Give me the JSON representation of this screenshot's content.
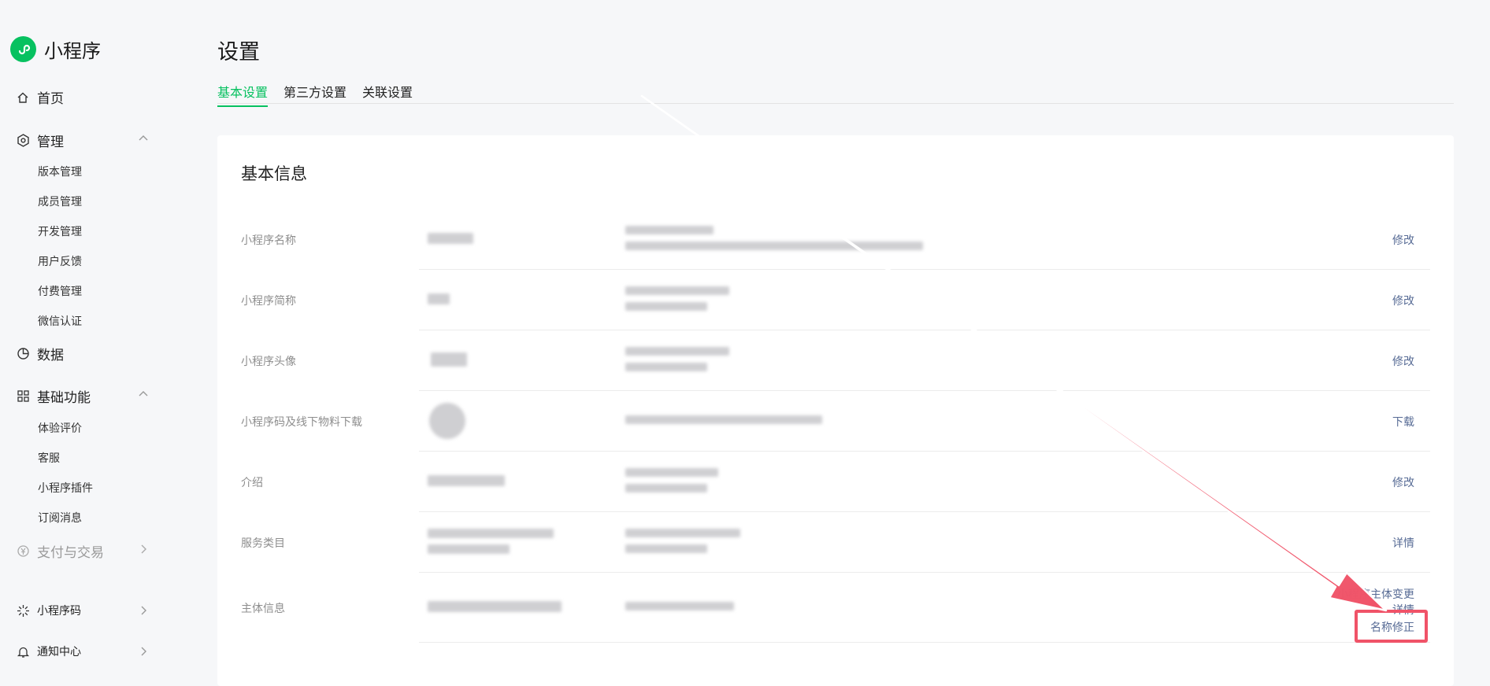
{
  "app": {
    "title": "小程序",
    "logo_icon": "mini-program-logo-icon",
    "brand_color": "#07c160"
  },
  "sidebar": {
    "home": {
      "label": "首页",
      "icon": "home-icon"
    },
    "manage": {
      "label": "管理",
      "icon": "gear-icon",
      "items": [
        "版本管理",
        "成员管理",
        "开发管理",
        "用户反馈",
        "付费管理",
        "微信认证"
      ]
    },
    "data": {
      "label": "数据",
      "icon": "pie-chart-icon"
    },
    "basic": {
      "label": "基础功能",
      "icon": "grid-icon",
      "items": [
        "体验评价",
        "客服",
        "小程序插件",
        "订阅消息"
      ]
    },
    "pay": {
      "label": "支付与交易",
      "icon": "yen-icon"
    },
    "qrcode": {
      "label": "小程序码",
      "icon": "sparkle-icon"
    },
    "notice": {
      "label": "通知中心",
      "icon": "bell-icon"
    }
  },
  "page": {
    "title": "设置"
  },
  "tabs": [
    {
      "label": "基本设置",
      "active": true
    },
    {
      "label": "第三方设置",
      "active": false
    },
    {
      "label": "关联设置",
      "active": false
    }
  ],
  "card": {
    "title": "基本信息",
    "rows": [
      {
        "label": "小程序名称",
        "action": "修改"
      },
      {
        "label": "小程序简称",
        "action": "修改"
      },
      {
        "label": "小程序头像",
        "action": "修改"
      },
      {
        "label": "小程序码及线下物料下载",
        "action": "下载"
      },
      {
        "label": "介绍",
        "action": "修改"
      },
      {
        "label": "服务类目",
        "action": "详情"
      },
      {
        "label": "主体信息",
        "action_1": "小程序主体变更",
        "action_2": "详情",
        "action_3": "名称修正"
      }
    ]
  },
  "annotation": {
    "arrow_color": "#f05368"
  }
}
